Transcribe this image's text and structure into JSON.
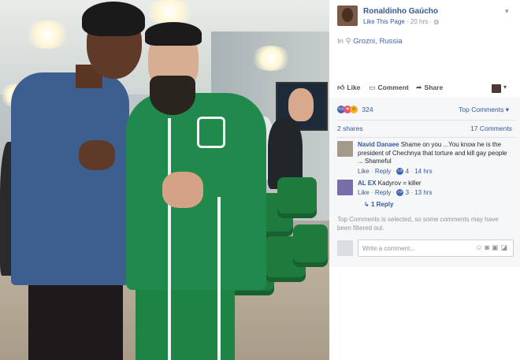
{
  "post": {
    "page_name": "Ronaldinho Gaúcho",
    "like_page": "Like This Page",
    "time": "20 hrs",
    "location_prefix": "In",
    "location": "Grozni, Russia"
  },
  "actions": {
    "like": "Like",
    "comment": "Comment",
    "share": "Share"
  },
  "reactions": {
    "count": "324",
    "sort_label": "Top Comments"
  },
  "stats": {
    "shares": "2 shares",
    "comments": "17 Comments"
  },
  "comments": [
    {
      "author": "Navid Danaee",
      "text": "Shame on you ...You know he is the president of Chechnya that torture and kill gay people ... Shameful",
      "like_label": "Like",
      "reply_label": "Reply",
      "likes": "4",
      "time": "14 hrs"
    },
    {
      "author": "AL EX",
      "text": "Kadyrov = killer",
      "like_label": "Like",
      "reply_label": "Reply",
      "likes": "3",
      "time": "13 hrs"
    }
  ],
  "replies_link": "1 Reply",
  "filter_note": "Top Comments is selected, so some comments may have been filtered out.",
  "composer": {
    "placeholder": "Write a comment..."
  },
  "colors": {
    "link": "#365899",
    "meta": "#90949c",
    "panel_grey": "#f6f7f9"
  }
}
